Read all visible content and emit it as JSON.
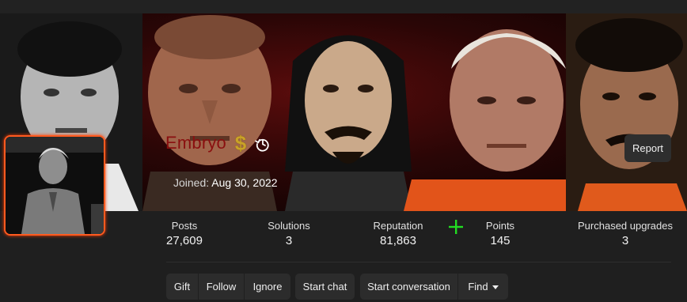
{
  "profile": {
    "username": "Embryo",
    "joined_label": "Joined:",
    "joined_date": "Aug 30, 2022",
    "report_label": "Report"
  },
  "stats": [
    {
      "label": "Posts",
      "value": "27,609"
    },
    {
      "label": "Solutions",
      "value": "3"
    },
    {
      "label": "Reputation",
      "value": "81,863"
    },
    {
      "label": "Points",
      "value": "145"
    },
    {
      "label": "Purchased upgrades",
      "value": "3"
    }
  ],
  "actions": {
    "group1": [
      "Gift",
      "Follow",
      "Ignore"
    ],
    "group2": [
      "Start chat"
    ],
    "group3": [
      "Start conversation",
      "Find"
    ]
  },
  "icons": {
    "badge": "dollar-icon",
    "history": "history-icon",
    "reputation": "plus-icon",
    "find_caret": "chevron-down-icon"
  },
  "colors": {
    "username": "#8a0f0f",
    "avatar_border": "#ff5a1f",
    "plus": "#22dd22",
    "badge": "#c9a227"
  }
}
